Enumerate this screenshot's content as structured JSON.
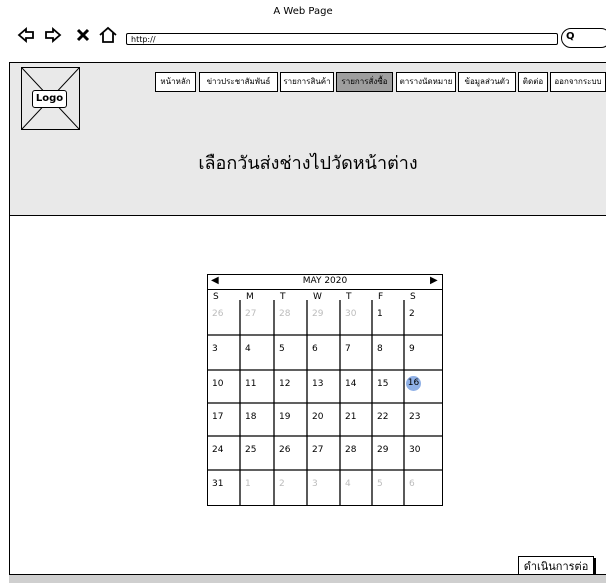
{
  "window": {
    "title": "A Web Page",
    "url": "http://"
  },
  "icons": [
    "back-arrow-icon",
    "forward-arrow-icon",
    "close-x-icon",
    "home-icon",
    "search-icon"
  ],
  "logo": {
    "label": "Logo"
  },
  "nav": {
    "items": [
      {
        "label": "หน้าหลัก"
      },
      {
        "label": "ข่าวประชาสัมพันธ์"
      },
      {
        "label": "รายการสินค้า"
      },
      {
        "label": "รายการสั่งซื้อ"
      },
      {
        "label": "ตารางนัดหมาย"
      },
      {
        "label": "ข้อมูลส่วนตัว"
      },
      {
        "label": "ติดต่อ"
      },
      {
        "label": "ออกจากระบบ"
      }
    ],
    "active_index": 3
  },
  "page": {
    "heading": "เลือกวันส่งช่างไปวัดหน้าต่าง"
  },
  "calendar": {
    "month_label": "MAY 2020",
    "weekdays": [
      "S",
      "M",
      "T",
      "W",
      "T",
      "F",
      "S"
    ],
    "weeks": [
      [
        "26",
        "27",
        "28",
        "29",
        "30",
        "1",
        "2"
      ],
      [
        "3",
        "4",
        "5",
        "6",
        "7",
        "8",
        "9"
      ],
      [
        "10",
        "11",
        "12",
        "13",
        "14",
        "15",
        "16"
      ],
      [
        "17",
        "18",
        "19",
        "20",
        "21",
        "22",
        "23"
      ],
      [
        "24",
        "25",
        "26",
        "27",
        "28",
        "29",
        "30"
      ],
      [
        "31",
        "1",
        "2",
        "3",
        "4",
        "5",
        "6"
      ]
    ],
    "muted_cells": [
      [
        0,
        0
      ],
      [
        0,
        1
      ],
      [
        0,
        2
      ],
      [
        0,
        3
      ],
      [
        0,
        4
      ],
      [
        5,
        1
      ],
      [
        5,
        2
      ],
      [
        5,
        3
      ],
      [
        5,
        4
      ],
      [
        5,
        5
      ],
      [
        5,
        6
      ]
    ],
    "selected_day": "16"
  },
  "actions": {
    "continue_label": "ดำเนินการต่อ"
  },
  "colors": {
    "header_bg": "#e9e9e9",
    "active_tab": "#9e9e9e",
    "selected_day": "#8fb0e6"
  }
}
